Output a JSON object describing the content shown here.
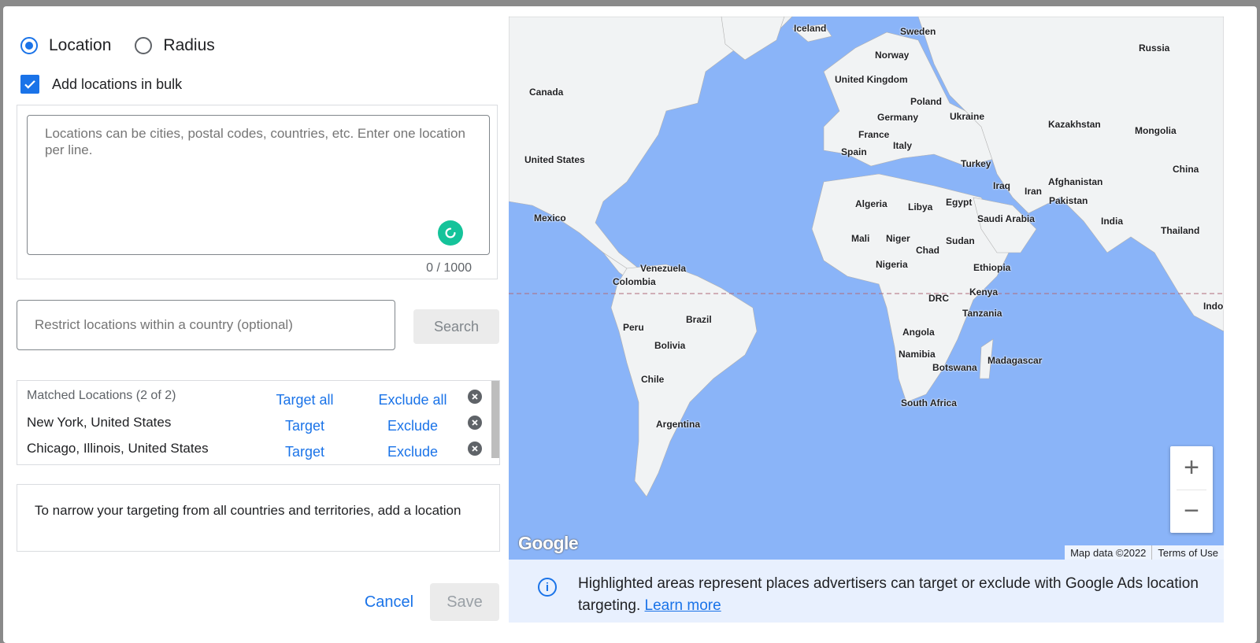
{
  "mode": {
    "options": [
      "Location",
      "Radius"
    ],
    "selected": "Location"
  },
  "bulk": {
    "checkbox_label": "Add locations in bulk",
    "checked": true,
    "textarea_placeholder": "Locations can be cities, postal codes, countries, etc. Enter one location per line.",
    "counter": "0 / 1000"
  },
  "restrict": {
    "placeholder": "Restrict locations within a country (optional)",
    "search_label": "Search"
  },
  "matched": {
    "header": "Matched Locations (2 of 2)",
    "target_all": "Target all",
    "exclude_all": "Exclude all",
    "rows": [
      {
        "name": "New York, United States",
        "target": "Target",
        "exclude": "Exclude"
      },
      {
        "name": "Chicago, Illinois, United States",
        "target": "Target",
        "exclude": "Exclude"
      }
    ]
  },
  "note": "To narrow your targeting from all countries and territories, add a location",
  "actions": {
    "cancel": "Cancel",
    "save": "Save"
  },
  "map": {
    "labels": [
      "Iceland",
      "Sweden",
      "Norway",
      "Russia",
      "Canada",
      "United Kingdom",
      "Poland",
      "Germany",
      "Ukraine",
      "Kazakhstan",
      "Mongolia",
      "France",
      "Italy",
      "Spain",
      "Turkey",
      "China",
      "Afghanistan",
      "Iraq",
      "Iran",
      "Pakistan",
      "United States",
      "Algeria",
      "Libya",
      "Egypt",
      "Saudi Arabia",
      "India",
      "Mexico",
      "Mali",
      "Niger",
      "Chad",
      "Sudan",
      "Thailand",
      "Nigeria",
      "Ethiopia",
      "Venezuela",
      "Colombia",
      "Kenya",
      "DRC",
      "Indor",
      "Tanzania",
      "Peru",
      "Brazil",
      "Angola",
      "Bolivia",
      "Namibia",
      "Madagascar",
      "Botswana",
      "Chile",
      "South Africa",
      "Argentina"
    ],
    "logo": "Google",
    "map_data": "Map data ©2022",
    "terms": "Terms of Use",
    "zoom_in": "+",
    "zoom_out": "−",
    "water_color": "#8ab4f8",
    "land_color": "#f1f3f4"
  },
  "info": {
    "text": "Highlighted areas represent places advertisers can target or exclude with Google Ads location targeting.",
    "link": "Learn more"
  },
  "colors": {
    "accent": "#1a73e8",
    "grammarly": "#15c39a"
  }
}
